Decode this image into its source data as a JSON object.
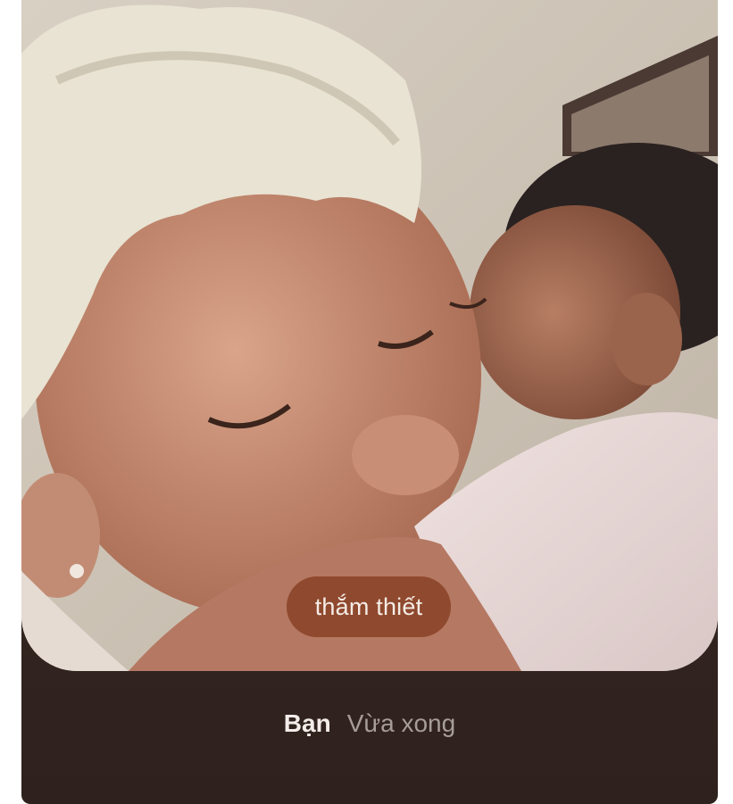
{
  "post": {
    "caption": "thắm thiết",
    "sender": "Bạn",
    "timestamp": "Vừa xong"
  },
  "colors": {
    "card_background": "#33251f",
    "caption_pill": "#8c462a",
    "sender_text": "#f3ece8",
    "timestamp_text": "#a79d98"
  }
}
